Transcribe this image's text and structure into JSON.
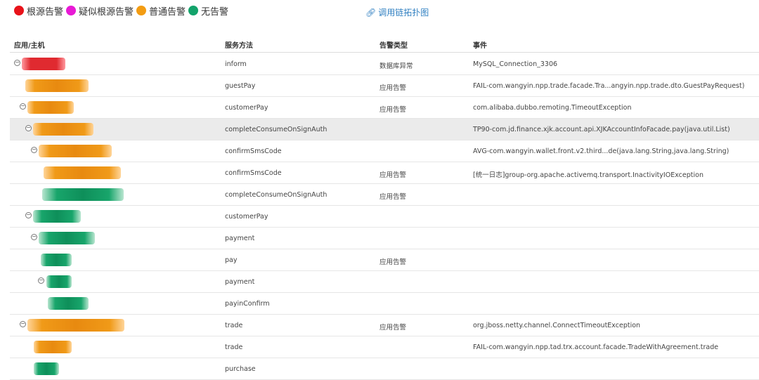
{
  "legend": [
    {
      "label": "根源告警",
      "color": "#e8131a"
    },
    {
      "label": "疑似根源告警",
      "color": "#e81ad5"
    },
    {
      "label": "普通告警",
      "color": "#f39c12"
    },
    {
      "label": "无告警",
      "color": "#13a36b"
    }
  ],
  "topology_link": {
    "icon": "link-icon",
    "label": "调用链拓扑图"
  },
  "table": {
    "headers": {
      "host": "应用/主机",
      "method": "服务方法",
      "alert_type": "告警类型",
      "event": "事件"
    },
    "rows": [
      {
        "method": "inform",
        "alert_type": "数据库异常",
        "event": "MySQL_Connection_3306"
      },
      {
        "method": "guestPay",
        "alert_type": "应用告警",
        "event": "FAIL-com.wangyin.npp.trade.facade.Tra...angyin.npp.trade.dto.GuestPayRequest)"
      },
      {
        "method": "customerPay",
        "alert_type": "应用告警",
        "event": "com.alibaba.dubbo.remoting.TimeoutException"
      },
      {
        "method": "completeConsumeOnSignAuth",
        "alert_type": "",
        "event": "TP90-com.jd.finance.xjk.account.api.XJKAccountInfoFacade.pay(java.util.List)"
      },
      {
        "method": "confirmSmsCode",
        "alert_type": "",
        "event": "AVG-com.wangyin.wallet.front.v2.third...de(java.lang.String,java.lang.String)"
      },
      {
        "method": "confirmSmsCode",
        "alert_type": "应用告警",
        "event": "[统一日志]group-org.apache.activemq.transport.InactivityIOException"
      },
      {
        "method": "completeConsumeOnSignAuth",
        "alert_type": "应用告警",
        "event": ""
      },
      {
        "method": "customerPay",
        "alert_type": "",
        "event": ""
      },
      {
        "method": "payment",
        "alert_type": "",
        "event": ""
      },
      {
        "method": "pay",
        "alert_type": "应用告警",
        "event": ""
      },
      {
        "method": "payment",
        "alert_type": "",
        "event": ""
      },
      {
        "method": "payinConfirm",
        "alert_type": "",
        "event": ""
      },
      {
        "method": "trade",
        "alert_type": "应用告警",
        "event": "org.jboss.netty.channel.ConnectTimeoutException"
      },
      {
        "method": "trade",
        "alert_type": "",
        "event": "FAIL-com.wangyin.npp.tad.trx.account.facade.TradeWithAgreement.trade"
      },
      {
        "method": "purchase",
        "alert_type": "",
        "event": ""
      }
    ]
  }
}
